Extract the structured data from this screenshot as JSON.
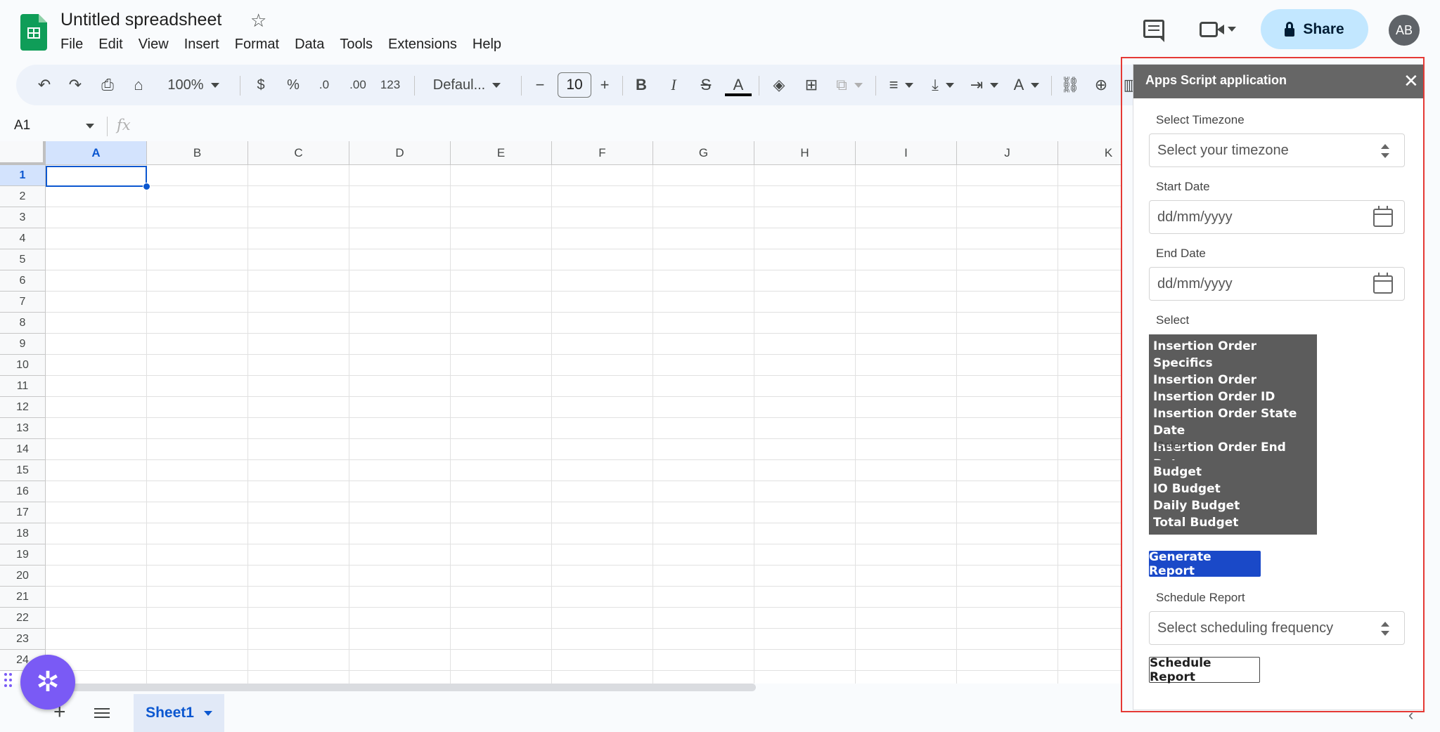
{
  "app": {
    "doc_title": "Untitled spreadsheet",
    "menu": [
      "File",
      "Edit",
      "View",
      "Insert",
      "Format",
      "Data",
      "Tools",
      "Extensions",
      "Help"
    ],
    "share_label": "Share",
    "avatar_initials": "AB"
  },
  "toolbar": {
    "zoom": "100%",
    "currency": "$",
    "percent": "%",
    "dec_decrease": ".0",
    "dec_increase": ".00",
    "number_format": "123",
    "font": "Defaul...",
    "font_size": "10",
    "bold": "B",
    "italic": "I",
    "strike": "S",
    "text_color": "A"
  },
  "formula_bar": {
    "cell_ref": "A1",
    "fx": "fx"
  },
  "grid": {
    "columns": [
      "A",
      "B",
      "C",
      "D",
      "E",
      "F",
      "G",
      "H",
      "I",
      "J",
      "K"
    ],
    "rows": [
      "1",
      "2",
      "3",
      "4",
      "5",
      "6",
      "7",
      "8",
      "9",
      "10",
      "11",
      "12",
      "13",
      "14",
      "15",
      "16",
      "17",
      "18",
      "19",
      "20",
      "21",
      "22",
      "23",
      "24"
    ],
    "selected_cell": "A1"
  },
  "sheets": {
    "add_label": "+",
    "active_tab": "Sheet1"
  },
  "sidebar": {
    "title": "Apps Script application",
    "timezone_label": "Select Timezone",
    "timezone_placeholder": "Select your timezone",
    "start_date_label": "Start Date",
    "start_date_placeholder": "dd/mm/yyyy",
    "end_date_label": "End Date",
    "end_date_placeholder": "dd/mm/yyyy",
    "select1_label": "Select",
    "select1_options": [
      "Insertion Order Specifics",
      "Insertion Order",
      "Insertion Order ID",
      "Insertion Order State Date",
      "Insertion Order End Date"
    ],
    "select2_label": "Select",
    "select2_options": [
      "Budget",
      "IO Budget",
      "Daily Budget",
      "Total Budget"
    ],
    "generate_label": "Generate Report",
    "schedule_label": "Schedule Report",
    "schedule_placeholder": "Select scheduling frequency",
    "schedule_button": "Schedule Report"
  },
  "colors": {
    "accent": "#0b57d0",
    "share_bg": "#c2e7ff",
    "sheets_green": "#0f9d58",
    "sidebar_header": "#666666",
    "generate_bg": "#1a49c8",
    "fab": "#7a5af5",
    "highlight": "#e53935"
  }
}
